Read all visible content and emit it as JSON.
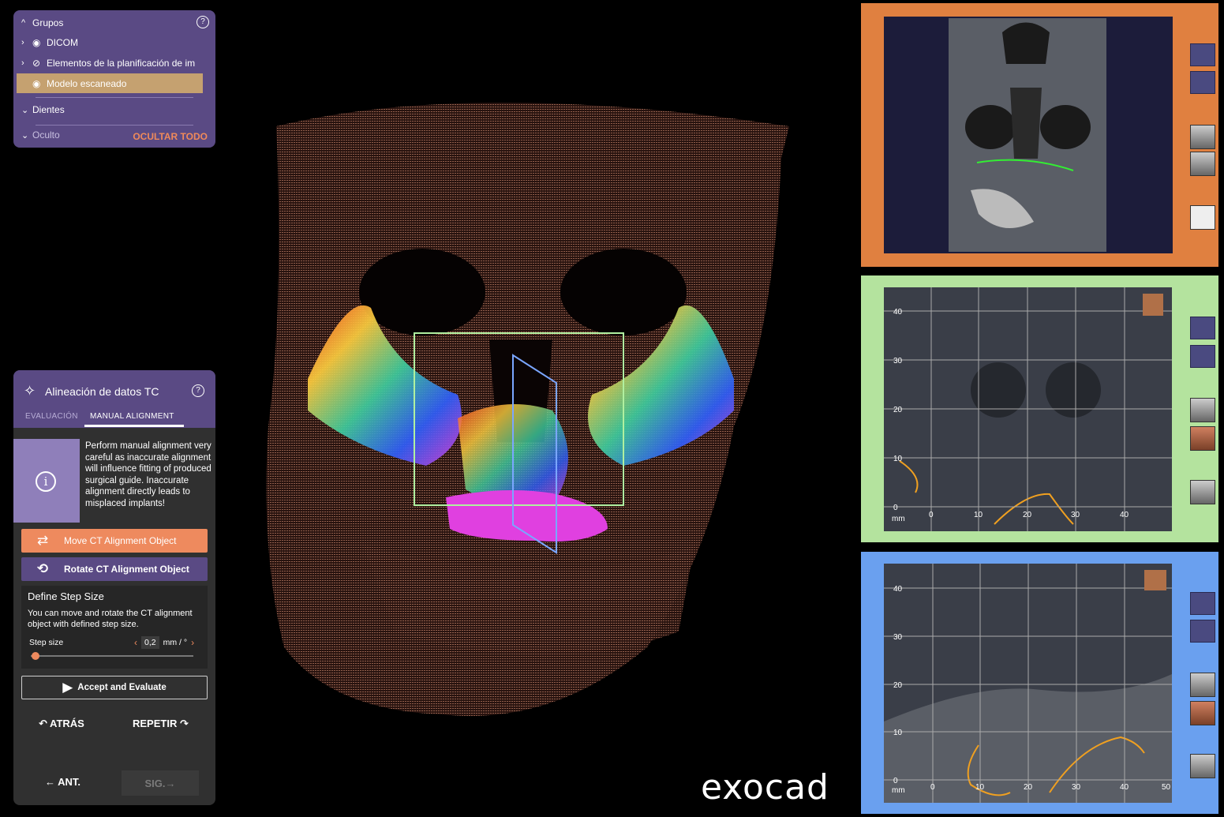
{
  "groups": {
    "title": "Grupos",
    "items": [
      {
        "label": "DICOM"
      },
      {
        "label": "Elementos de la planificación de im"
      },
      {
        "label": "Modelo escaneado"
      },
      {
        "label": "Dientes"
      },
      {
        "label": "Oculto"
      }
    ],
    "hide_all": "OCULTAR TODO"
  },
  "alignment": {
    "title": "Alineación de datos TC",
    "tabs": [
      "EVALUACIÓN",
      "MANUAL ALIGNMENT"
    ],
    "info_text": "Perform manual alignment very careful as inaccurate alignment will influence fitting of produced surgical guide. Inaccurate alignment directly leads to misplaced implants!",
    "move_button": "Move CT Alignment Object",
    "rotate_button": "Rotate CT Alignment Object",
    "step_title": "Define Step Size",
    "step_desc": "You can move and rotate the CT alignment object with defined step size.",
    "step_label": "Step size",
    "step_value": "0,2",
    "step_unit": "mm / °",
    "step_fraction": 0.03,
    "accept_button": "Accept and Evaluate",
    "undo": "ATRÁS",
    "redo": "REPETIR",
    "prev": "ANT.",
    "next": "SIG."
  },
  "brand": "exocad",
  "views": {
    "axis_unit": "mm",
    "v2_y_ticks": [
      "40",
      "30",
      "20",
      "10",
      "0"
    ],
    "v2_x_ticks": [
      "0",
      "10",
      "20",
      "30",
      "40"
    ],
    "v3_y_ticks": [
      "40",
      "30",
      "20",
      "10",
      "0"
    ],
    "v3_x_ticks": [
      "0",
      "10",
      "20",
      "30",
      "40",
      "50"
    ]
  },
  "colors": {
    "panel_purple": "#5a4a84",
    "accent_orange": "#ee8a5e",
    "selected_row": "#c5a170",
    "view1_frame": "#e08040",
    "view2_frame": "#b4e39e",
    "view3_frame": "#6aa0ef"
  },
  "icons": {
    "help": "help-icon",
    "eye": "eye-icon",
    "eye_hidden": "eye-slash-icon",
    "wand": "magic-wand-icon",
    "info": "info-icon",
    "move": "arrows-swap-icon",
    "rotate": "rotate-icon",
    "play": "play-icon",
    "undo": "undo-icon",
    "redo": "redo-icon",
    "arrow_left": "arrow-left-icon",
    "arrow_right": "arrow-right-icon"
  }
}
